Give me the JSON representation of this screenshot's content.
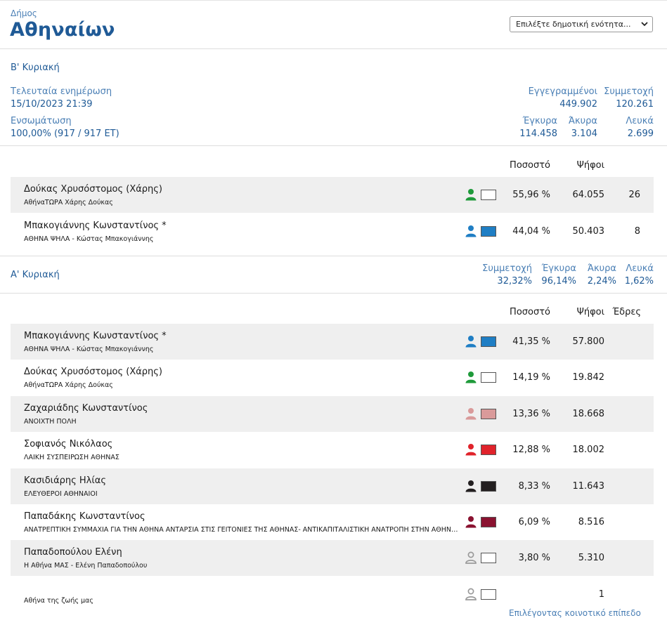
{
  "header": {
    "municipality_label": "Δήμος",
    "municipality_name": "Αθηναίων",
    "unit_select_placeholder": "Επιλέξτε δημοτική ενότητα..."
  },
  "round_b": {
    "title": "Β' Κυριακή",
    "last_update_label": "Τελευταία ενημέρωση",
    "last_update_value": "15/10/2023 21:39",
    "integration_label": "Ενσωμάτωση",
    "integration_value": "100,00% (917 / 917 ΕΤ)",
    "registered_label": "Εγγεγραμμένοι",
    "registered_value": "449.902",
    "turnout_label": "Συμμετοχή",
    "turnout_value": "120.261",
    "valid_label": "Έγκυρα",
    "valid_value": "114.458",
    "invalid_label": "Άκυρα",
    "invalid_value": "3.104",
    "blank_label": "Λευκά",
    "blank_value": "2.699",
    "col_percent": "Ποσοστό",
    "col_votes": "Ψήφοι",
    "candidates": [
      {
        "name": "Δούκας Χρυσόστομος (Χάρης)",
        "party": "ΑθήναΤΩΡΑ Χάρης Δούκας",
        "percent": "55,96 %",
        "votes": "64.055",
        "seats": "26",
        "color": "#ffffff",
        "person_color": "#1e9a3a"
      },
      {
        "name": "Μπακογιάννης Κωνσταντίνος *",
        "party": "ΑΘΗΝΑ ΨΗΛΑ - Κώστας Μπακογιάννης",
        "percent": "44,04 %",
        "votes": "50.403",
        "seats": "8",
        "color": "#1f7ec4",
        "person_color": "#1f7ec4"
      }
    ]
  },
  "round_a": {
    "title": "Α' Κυριακή",
    "turnout_label": "Συμμετοχή",
    "turnout_value": "32,32%",
    "valid_label": "Έγκυρα",
    "valid_value": "96,14%",
    "invalid_label": "Άκυρα",
    "invalid_value": "2,24%",
    "blank_label": "Λευκά",
    "blank_value": "1,62%",
    "col_percent": "Ποσοστό",
    "col_votes": "Ψήφοι",
    "col_seats": "Έδρες",
    "candidates": [
      {
        "name": "Μπακογιάννης Κωνσταντίνος *",
        "party": "ΑΘΗΝΑ ΨΗΛΑ - Κώστας Μπακογιάννης",
        "percent": "41,35 %",
        "votes": "57.800",
        "color": "#1f7ec4",
        "person_color": "#1f7ec4"
      },
      {
        "name": "Δούκας Χρυσόστομος (Χάρης)",
        "party": "ΑθήναΤΩΡΑ Χάρης Δούκας",
        "percent": "14,19 %",
        "votes": "19.842",
        "color": "#ffffff",
        "person_color": "#1e9a3a"
      },
      {
        "name": "Ζαχαριάδης Κωνσταντίνος",
        "party": "ΑΝΟΙΧΤΗ ΠΟΛΗ",
        "percent": "13,36 %",
        "votes": "18.668",
        "color": "#d99a9a",
        "person_color": "#d99a9a"
      },
      {
        "name": "Σοφιανός Νικόλαος",
        "party": "ΛΑΪΚΗ ΣΥΣΠΕΙΡΩΣΗ ΑΘΗΝΑΣ",
        "percent": "12,88 %",
        "votes": "18.002",
        "color": "#e0232b",
        "person_color": "#e0232b"
      },
      {
        "name": "Κασιδιάρης Ηλίας",
        "party": "ΕΛΕΥΘΕΡΟΙ ΑΘΗΝΑΙΟΙ",
        "percent": "8,33 %",
        "votes": "11.643",
        "color": "#231f20",
        "person_color": "#231f20"
      },
      {
        "name": "Παπαδάκης Κωνσταντίνος",
        "party": "ΑΝΑΤΡΕΠΤΙΚΗ ΣΥΜΜΑΧΙΑ ΓΙΑ ΤΗΝ ΑΘΗΝΑ ΑΝΤΑΡΣΙΑ ΣΤΙΣ ΓΕΙΤΟΝΙΕΣ ΤΗΣ ΑΘΗΝΑΣ- ΑΝΤΙΚΑΠΙΤΑΛΙΣΤΙΚΗ ΑΝΑΤΡΟΠΗ ΣΤΗΝ ΑΘΗΝΑ/ ΑΝΤΑΡΣΙΑ",
        "percent": "6,09 %",
        "votes": "8.516",
        "color": "#8a1230",
        "person_color": "#8a1230"
      },
      {
        "name": "Παπαδοπούλου Ελένη",
        "party": "Η Αθήνα ΜΑΣ - Ελένη Παπαδοπούλου",
        "percent": "3,80 %",
        "votes": "5.310",
        "color": "#ffffff",
        "person_color": "#9a9a9a",
        "outline": true
      },
      {
        "name": "",
        "party": "Αθήνα της ζωής μας",
        "percent": "",
        "votes": "1",
        "color": "#ffffff",
        "person_color": "#9a9a9a",
        "outline": true
      }
    ]
  },
  "footer": {
    "link_text": "Επιλέγοντας κοινοτικό επίπεδο"
  },
  "icons": {
    "person": "person-icon",
    "chevron": "chevron-down-icon"
  }
}
